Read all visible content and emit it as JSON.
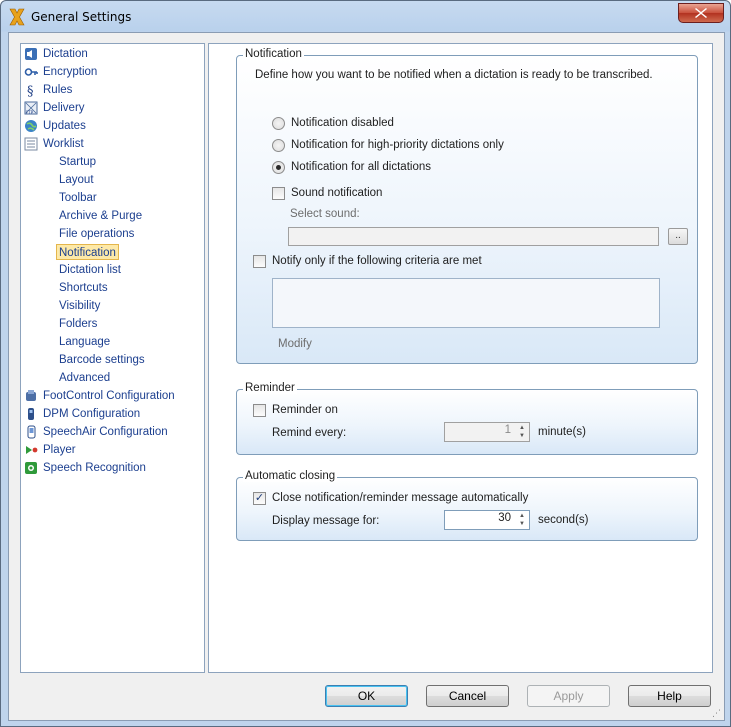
{
  "window": {
    "title": "General Settings"
  },
  "tree": {
    "top_items": [
      {
        "label": "Dictation",
        "icon": "speaker-icon"
      },
      {
        "label": "Encryption",
        "icon": "key-icon"
      },
      {
        "label": "Rules",
        "icon": "section-sign-icon"
      },
      {
        "label": "Delivery",
        "icon": "ftp-icon"
      },
      {
        "label": "Updates",
        "icon": "globe-icon"
      },
      {
        "label": "Worklist",
        "icon": "list-icon"
      }
    ],
    "worklist_children": [
      "Startup",
      "Layout",
      "Toolbar",
      "Archive & Purge",
      "File operations",
      "Notification",
      "Dictation list",
      "Shortcuts",
      "Visibility",
      "Folders",
      "Language",
      "Barcode settings",
      "Advanced"
    ],
    "selected": "Notification",
    "bottom_items": [
      {
        "label": "FootControl Configuration",
        "icon": "footcontrol-icon"
      },
      {
        "label": "DPM Configuration",
        "icon": "recorder-icon"
      },
      {
        "label": "SpeechAir Configuration",
        "icon": "speechair-icon"
      },
      {
        "label": "Player",
        "icon": "player-icon"
      },
      {
        "label": "Speech Recognition",
        "icon": "speech-recognition-icon"
      }
    ]
  },
  "notification": {
    "legend": "Notification",
    "description": "Define how you want to be notified when a dictation is ready to be transcribed.",
    "radio_disabled": "Notification disabled",
    "radio_high_priority": "Notification for high-priority dictations only",
    "radio_all": "Notification for all dictations",
    "selected_radio": "all",
    "sound_notification": "Sound notification",
    "sound_checked": false,
    "select_sound_label": "Select sound:",
    "select_sound_value": "",
    "browse_label": "..",
    "criteria_label": "Notify only if the following criteria are met",
    "criteria_checked": false,
    "modify_label": "Modify"
  },
  "reminder": {
    "legend": "Reminder",
    "reminder_on": "Reminder on",
    "reminder_checked": false,
    "remind_every_label": "Remind every:",
    "remind_every_value": "1",
    "unit": "minute(s)"
  },
  "auto_closing": {
    "legend": "Automatic closing",
    "close_label": "Close notification/reminder message automatically",
    "close_checked": true,
    "display_for_label": "Display message for:",
    "display_for_value": "30",
    "unit": "second(s)"
  },
  "buttons": {
    "ok": "OK",
    "cancel": "Cancel",
    "apply": "Apply",
    "help": "Help"
  },
  "colors": {
    "link_blue": "#1c3f8f",
    "selection": "#fde9a8",
    "close_red": "#c9503c"
  }
}
